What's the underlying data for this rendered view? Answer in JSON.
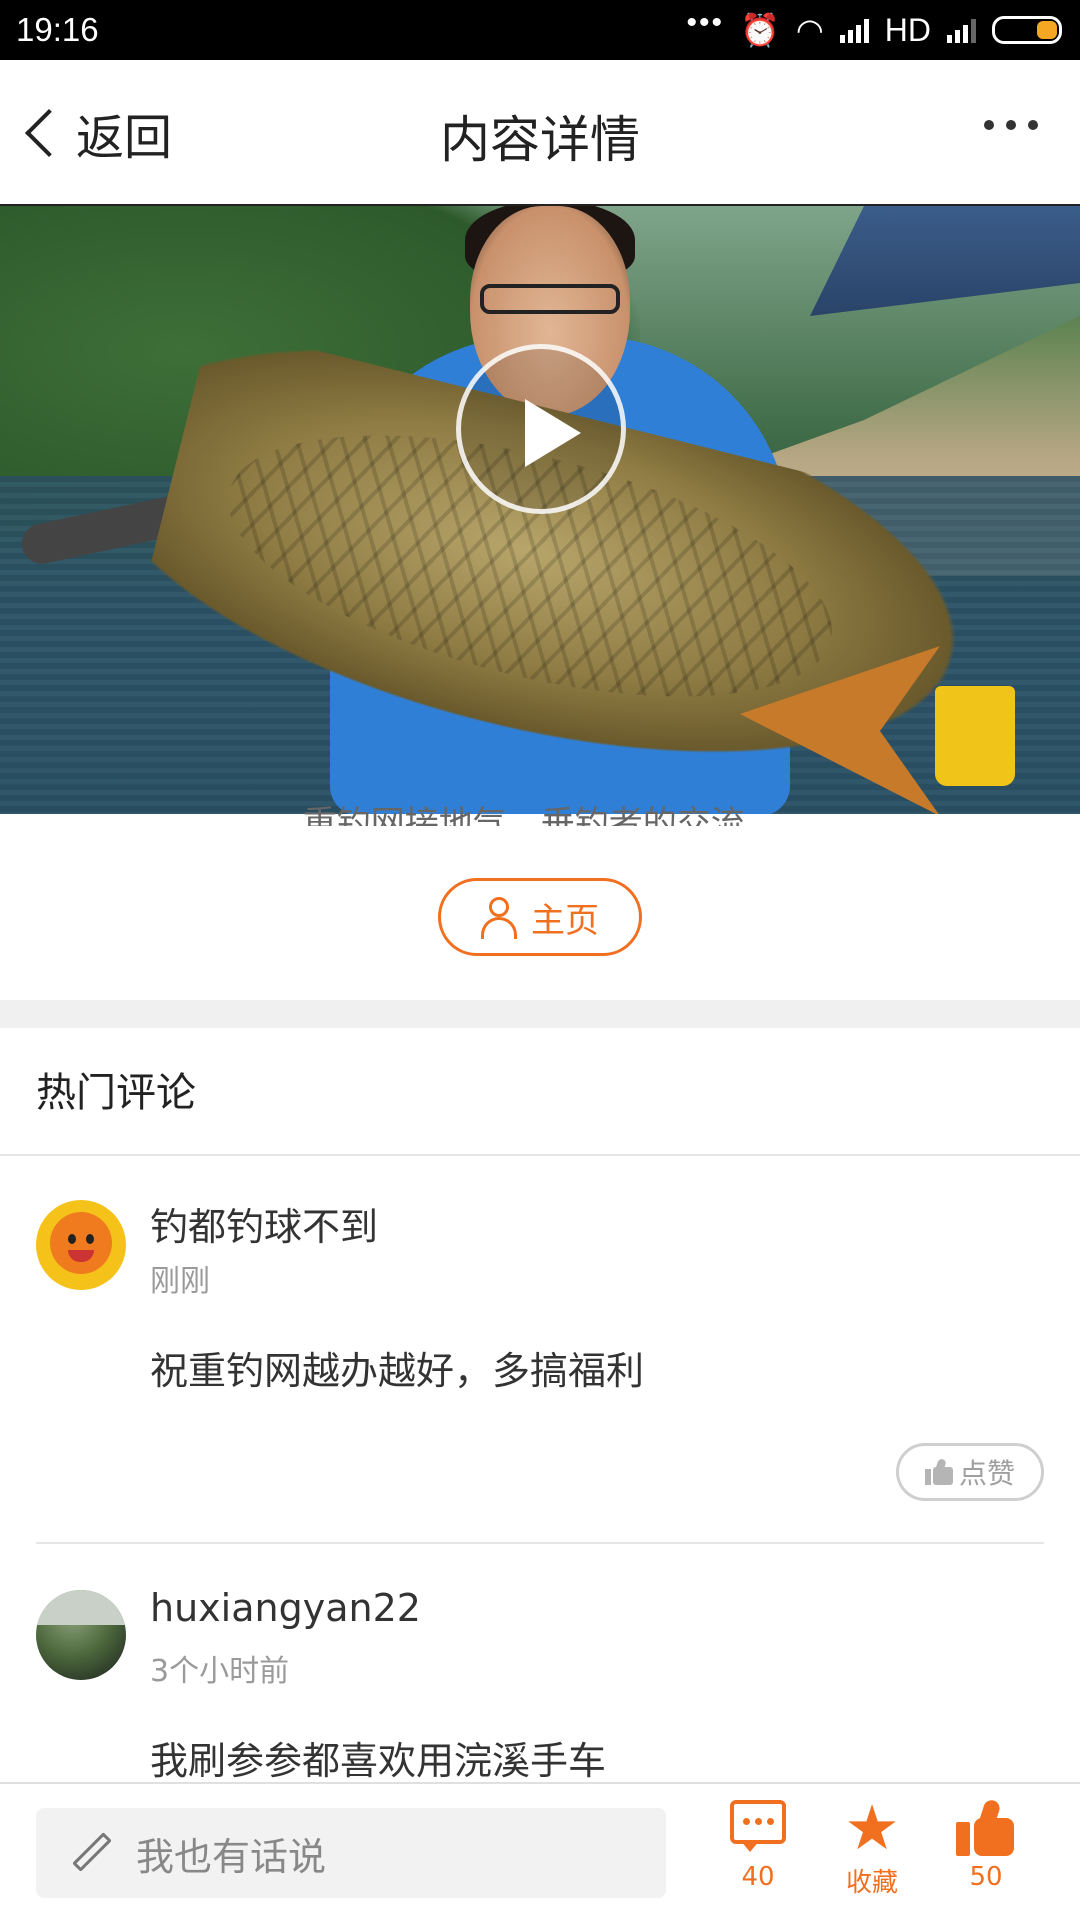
{
  "status_bar": {
    "time": "19:16",
    "network_label": "HD",
    "battery_color": "#f5a623"
  },
  "header": {
    "back_label": "返回",
    "title": "内容详情",
    "more_icon": "more-dots-icon"
  },
  "video": {
    "play_icon": "play-icon",
    "description": "重钓网接地气，垂钓者的交流..."
  },
  "author": {
    "home_label": "主页",
    "home_icon": "user-icon"
  },
  "comments_section": {
    "title": "热门评论",
    "items": [
      {
        "username": "钓都钓球不到",
        "time": "刚刚",
        "text": "祝重钓网越办越好，多搞福利",
        "like_label": "点赞"
      },
      {
        "username": "huxiangyan22",
        "time": "3个小时前",
        "text": "我刷参参都喜欢用浣溪手车"
      }
    ]
  },
  "bottom_bar": {
    "input_placeholder": "我也有话说",
    "comment_count": "40",
    "favorite_label": "收藏",
    "like_count": "50",
    "accent_color": "#f07020"
  }
}
